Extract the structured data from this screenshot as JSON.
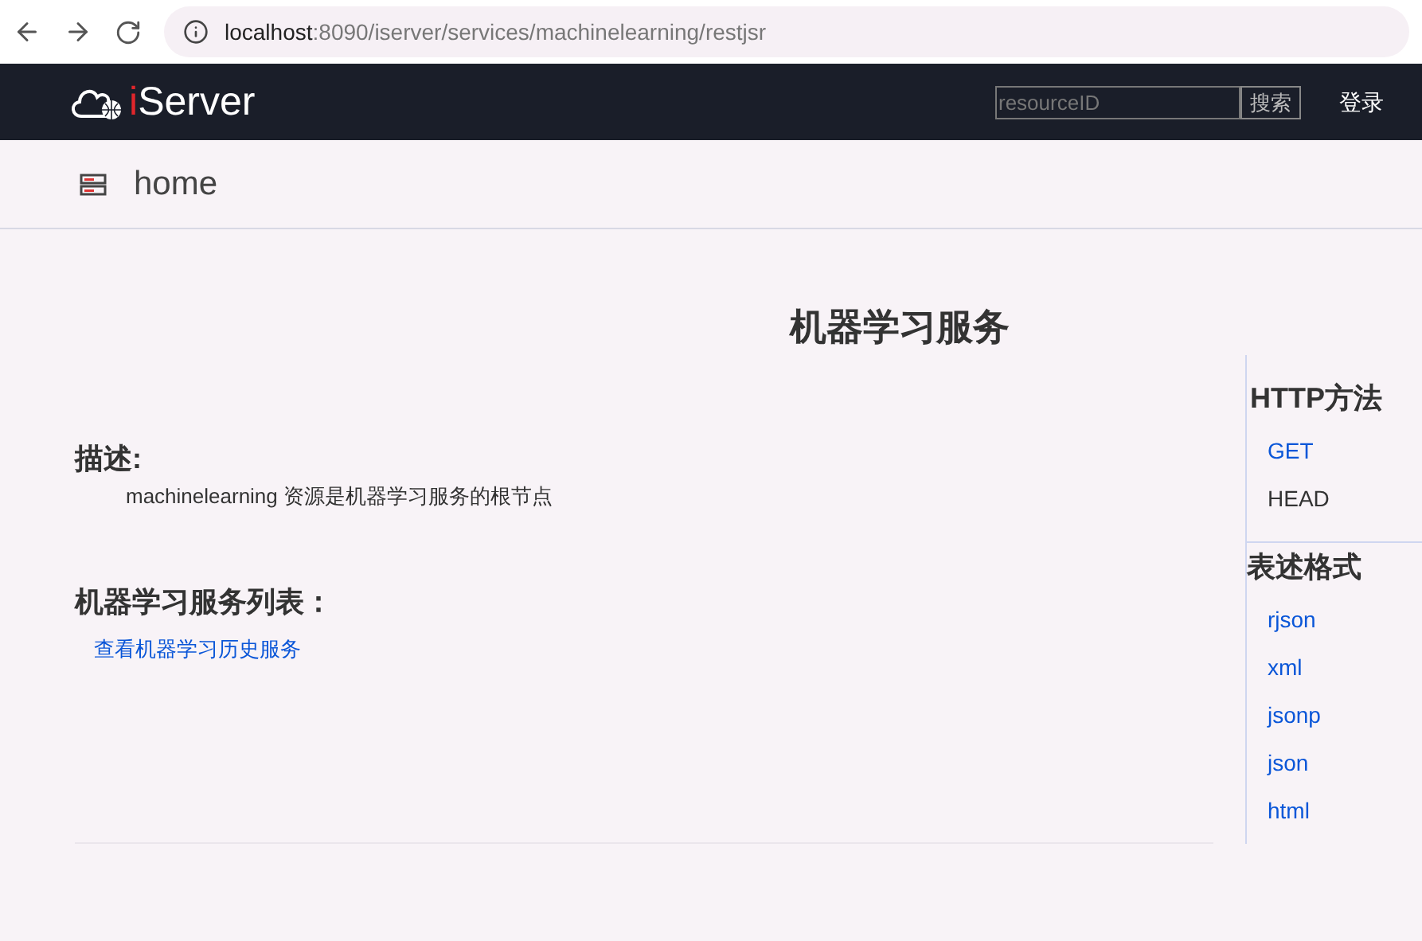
{
  "browser": {
    "url_host": "localhost",
    "url_path": ":8090/iserver/services/machinelearning/restjsr"
  },
  "header": {
    "logo_prefix": "i",
    "logo_name": "Server",
    "search": {
      "placeholder": "resourceID"
    },
    "search_button": "搜索",
    "login": "登录"
  },
  "breadcrumb": {
    "label": "home"
  },
  "title": "机器学习服务",
  "description": {
    "heading": "描述:",
    "text": "machinelearning 资源是机器学习服务的根节点"
  },
  "service_list": {
    "heading": "机器学习服务列表：",
    "links": [
      "查看机器学习历史服务"
    ]
  },
  "sidebar": {
    "methods_heading": "HTTP方法",
    "methods": [
      {
        "label": "GET",
        "kind": "link"
      },
      {
        "label": "HEAD",
        "kind": "text"
      }
    ],
    "formats_heading": "表述格式",
    "formats": [
      "rjson",
      "xml",
      "jsonp",
      "json",
      "html"
    ]
  }
}
